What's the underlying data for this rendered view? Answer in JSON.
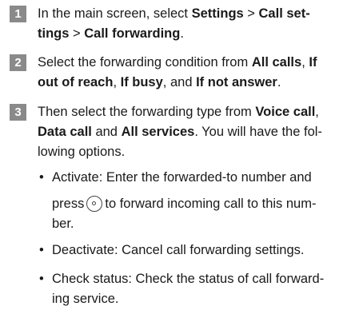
{
  "steps": [
    {
      "num": "1",
      "l1a": "In the main screen, select ",
      "l1b": "Settings",
      "l1c": " > ",
      "l1d": "Call set-",
      "l2a": "tings",
      "l2b": " > ",
      "l2c": "Call forwarding",
      "l2d": "."
    },
    {
      "num": "2",
      "l1a": "Select the forwarding condition from ",
      "l1b": "All calls",
      "l1c": ", ",
      "l1d": "If",
      "l2a": "out of reach",
      "l2b": ", ",
      "l2c": "If busy",
      "l2d": ", and ",
      "l2e": "If not answer",
      "l2f": "."
    },
    {
      "num": "3",
      "l1a": "Then select the forwarding type from ",
      "l1b": "Voice call",
      "l1c": ",",
      "l2a": "Data call",
      "l2b": " and ",
      "l2c": "All services",
      "l2d": ". You will have the fol-",
      "l3a": "lowing options."
    }
  ],
  "options": {
    "activate": {
      "l1": "Activate: Enter the forwarded-to number and",
      "l2a": "press",
      "icon": "ok-key-icon",
      "l2b": "to forward incoming call to this num-",
      "l3": "ber."
    },
    "deactivate": {
      "l1": "Deactivate: Cancel call forwarding settings."
    },
    "check_status": {
      "l1": "Check status: Check the status of call forward-",
      "l2": "ing service."
    },
    "bullet": "•"
  }
}
